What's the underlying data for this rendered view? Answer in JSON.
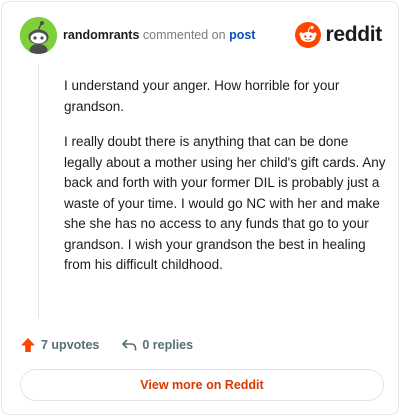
{
  "comment": {
    "username": "randomrants",
    "action": "commented on",
    "post_link": "post",
    "paragraphs": [
      "I understand your anger. How horrible for your grandson.",
      "I really doubt there is anything that can be done legally about a mother using her child's gift cards. Any back and forth with your former DIL is probably just a waste of your time. I would go NC with her and make she she has no access to any funds that go to your grandson. I wish your grandson the best in healing from his difficult childhood."
    ]
  },
  "brand": {
    "name": "reddit",
    "color": "#ff4500",
    "icon": "reddit-snoo-icon"
  },
  "stats": {
    "upvotes": "7 upvotes",
    "replies": "0 replies"
  },
  "footer": {
    "view_more": "View more on Reddit"
  },
  "colors": {
    "accent": "#d93a00",
    "link": "#0a4fb5",
    "avatar_bg": "#7ecf3a"
  }
}
